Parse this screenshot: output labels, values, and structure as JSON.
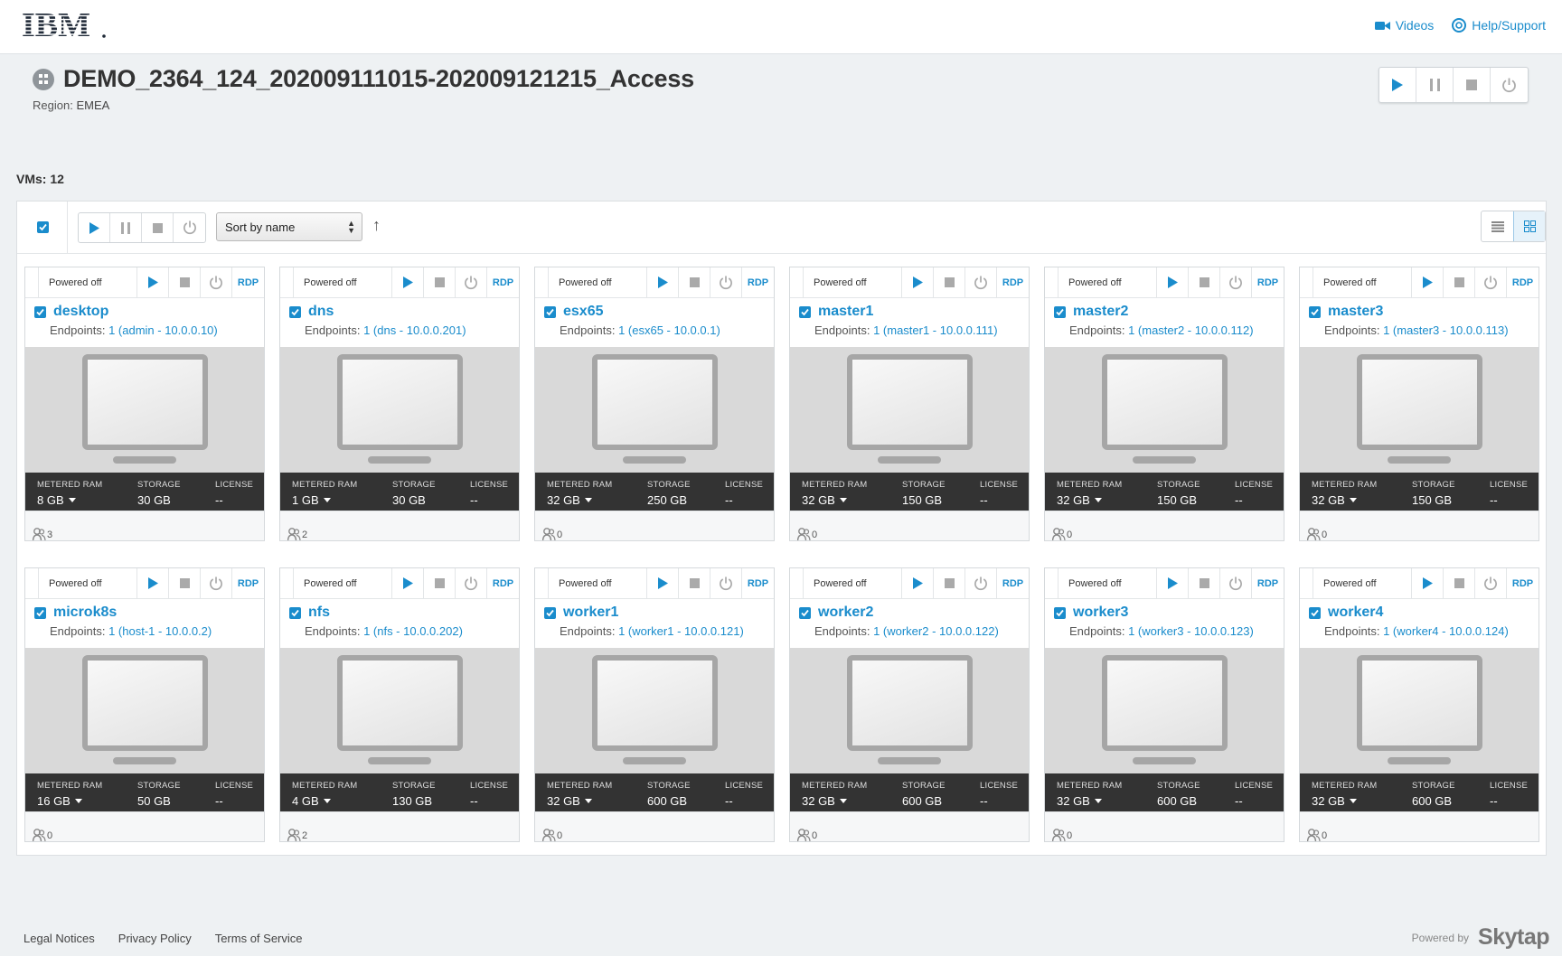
{
  "header": {
    "logo": "IBM",
    "links": [
      {
        "label": "Videos"
      },
      {
        "label": "Help/Support"
      }
    ]
  },
  "environment": {
    "title": "DEMO_2364_124_202009111015-202009121215_Access",
    "region_label": "Region:",
    "region_value": "EMEA"
  },
  "vm_count": "VMs: 12",
  "toolbar": {
    "sort_label": "Sort by name",
    "sort_direction": "↑"
  },
  "card_labels": {
    "ram": "METERED RAM",
    "storage": "STORAGE",
    "license": "LICENSE",
    "rdp": "RDP",
    "endpoints": "Endpoints:"
  },
  "vms": [
    {
      "name": "desktop",
      "status": "Powered off",
      "endpoint": "1 (admin - 10.0.0.10)",
      "ram": "8 GB",
      "storage": "30 GB",
      "license": "--",
      "users": "3"
    },
    {
      "name": "dns",
      "status": "Powered off",
      "endpoint": "1 (dns - 10.0.0.201)",
      "ram": "1 GB",
      "storage": "30 GB",
      "license": "--",
      "users": "2"
    },
    {
      "name": "esx65",
      "status": "Powered off",
      "endpoint": "1 (esx65 - 10.0.0.1)",
      "ram": "32 GB",
      "storage": "250 GB",
      "license": "--",
      "users": "0"
    },
    {
      "name": "master1",
      "status": "Powered off",
      "endpoint": "1 (master1 - 10.0.0.111)",
      "ram": "32 GB",
      "storage": "150 GB",
      "license": "--",
      "users": "0"
    },
    {
      "name": "master2",
      "status": "Powered off",
      "endpoint": "1 (master2 - 10.0.0.112)",
      "ram": "32 GB",
      "storage": "150 GB",
      "license": "--",
      "users": "0"
    },
    {
      "name": "master3",
      "status": "Powered off",
      "endpoint": "1 (master3 - 10.0.0.113)",
      "ram": "32 GB",
      "storage": "150 GB",
      "license": "--",
      "users": "0"
    },
    {
      "name": "microk8s",
      "status": "Powered off",
      "endpoint": "1 (host-1 - 10.0.0.2)",
      "ram": "16 GB",
      "storage": "50 GB",
      "license": "--",
      "users": "0"
    },
    {
      "name": "nfs",
      "status": "Powered off",
      "endpoint": "1 (nfs - 10.0.0.202)",
      "ram": "4 GB",
      "storage": "130 GB",
      "license": "--",
      "users": "2"
    },
    {
      "name": "worker1",
      "status": "Powered off",
      "endpoint": "1 (worker1 - 10.0.0.121)",
      "ram": "32 GB",
      "storage": "600 GB",
      "license": "--",
      "users": "0"
    },
    {
      "name": "worker2",
      "status": "Powered off",
      "endpoint": "1 (worker2 - 10.0.0.122)",
      "ram": "32 GB",
      "storage": "600 GB",
      "license": "--",
      "users": "0"
    },
    {
      "name": "worker3",
      "status": "Powered off",
      "endpoint": "1 (worker3 - 10.0.0.123)",
      "ram": "32 GB",
      "storage": "600 GB",
      "license": "--",
      "users": "0"
    },
    {
      "name": "worker4",
      "status": "Powered off",
      "endpoint": "1 (worker4 - 10.0.0.124)",
      "ram": "32 GB",
      "storage": "600 GB",
      "license": "--",
      "users": "0"
    }
  ],
  "footer": {
    "links": [
      {
        "label": "Legal Notices"
      },
      {
        "label": "Privacy Policy"
      },
      {
        "label": "Terms of Service"
      }
    ],
    "powered_by": "Powered by",
    "brand": "Skytap"
  },
  "colors": {
    "accent": "#1a8ccc",
    "stats_bar": "#333333",
    "background": "#eef1f3"
  }
}
